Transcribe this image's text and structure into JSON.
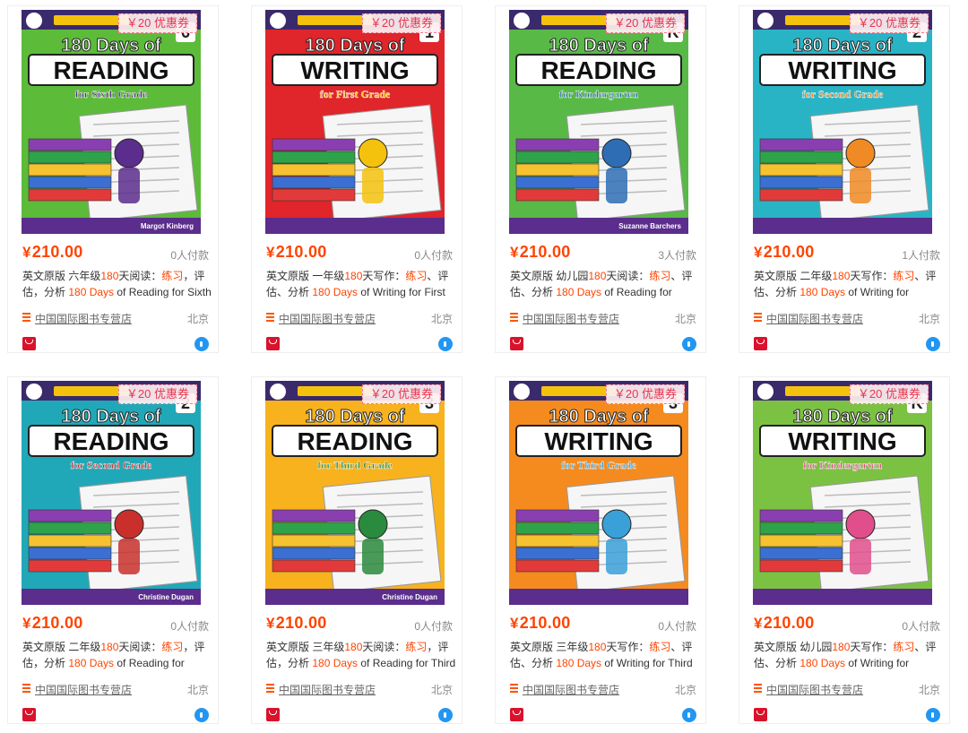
{
  "coupon": "￥20 优惠券",
  "currency": "¥",
  "shop": "中国国际图书专营店",
  "location": "北京",
  "products": [
    {
      "price": "210.00",
      "sold": "0人付款",
      "title": [
        "英文原版 六年级",
        "180",
        "天阅读：",
        "练习",
        "，评估，分析 ",
        "180 Days",
        " of Reading for Sixth"
      ],
      "cover": {
        "bg": "#5dbb3a",
        "word": "READING",
        "sub": "for Sixth Grade",
        "grade": "6",
        "author": "Margot Kinberg",
        "accent": "#5b2d8c"
      }
    },
    {
      "price": "210.00",
      "sold": "0人付款",
      "title": [
        "英文原版 一年级",
        "180",
        "天写作：",
        "练习",
        "、评估、分析 ",
        "180 Days",
        " of Writing for First"
      ],
      "cover": {
        "bg": "#e0252b",
        "word": "WRITING",
        "sub": "for First Grade",
        "grade": "1",
        "author": "",
        "accent": "#f4c20d"
      }
    },
    {
      "price": "210.00",
      "sold": "3人付款",
      "title": [
        "英文原版 幼儿园",
        "180",
        "天阅读：",
        "练习",
        "、评估、分析 ",
        "180 Days",
        " of Reading for"
      ],
      "cover": {
        "bg": "#59b947",
        "word": "READING",
        "sub": "for Kindergarten",
        "grade": "K",
        "author": "Suzanne Barchers",
        "accent": "#2e6db4"
      }
    },
    {
      "price": "210.00",
      "sold": "1人付款",
      "title": [
        "英文原版 二年级",
        "180",
        "天写作：",
        "练习",
        "、评估、分析 ",
        "180 Days",
        " of Writing for Second"
      ],
      "cover": {
        "bg": "#29b4c6",
        "word": "WRITING",
        "sub": "for Second Grade",
        "grade": "2",
        "author": "",
        "accent": "#f08a24"
      }
    },
    {
      "price": "210.00",
      "sold": "0人付款",
      "title": [
        "英文原版 二年级",
        "180",
        "天阅读：",
        "练习",
        "，评估，分析 ",
        "180 Days",
        " of Reading for Second"
      ],
      "cover": {
        "bg": "#21a8b8",
        "word": "READING",
        "sub": "for Second Grade",
        "grade": "2",
        "author": "Christine Dugan",
        "accent": "#c9302c"
      }
    },
    {
      "price": "210.00",
      "sold": "0人付款",
      "title": [
        "英文原版 三年级",
        "180",
        "天阅读：",
        "练习",
        "，评估，分析 ",
        "180 Days",
        " of Reading for Third"
      ],
      "cover": {
        "bg": "#f7b21e",
        "word": "READING",
        "sub": "for Third Grade",
        "grade": "3",
        "author": "Christine Dugan",
        "accent": "#2a8a3d"
      }
    },
    {
      "price": "210.00",
      "sold": "0人付款",
      "title": [
        "英文原版 三年级",
        "180",
        "天写作：",
        "练习",
        "、评估、分析 ",
        "180 Days",
        " of Writing for Third"
      ],
      "cover": {
        "bg": "#f58b1f",
        "word": "WRITING",
        "sub": "for Third Grade",
        "grade": "3",
        "author": "",
        "accent": "#3aa0d8"
      }
    },
    {
      "price": "210.00",
      "sold": "0人付款",
      "title": [
        "英文原版 幼儿园",
        "180",
        "天写作：",
        "练习",
        "、评估、分析 ",
        "180 Days",
        " of Writing for Kindergarten:"
      ],
      "cover": {
        "bg": "#7cc242",
        "word": "WRITING",
        "sub": "for Kindergarten",
        "grade": "K",
        "author": "",
        "accent": "#e04f8c"
      }
    }
  ]
}
